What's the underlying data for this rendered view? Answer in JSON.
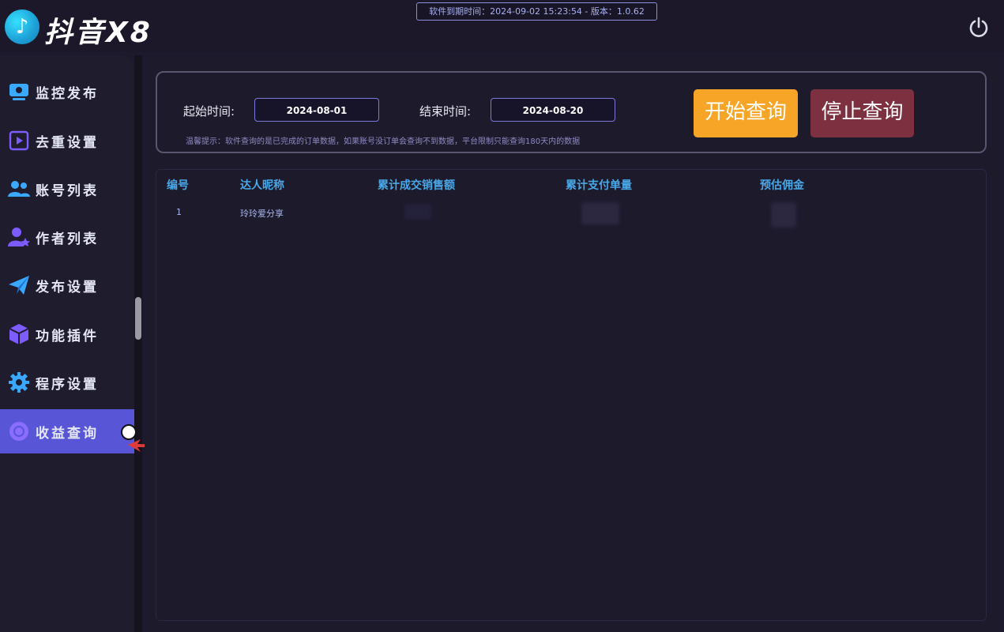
{
  "header": {
    "logo_glyph": "♪",
    "app_title": "抖音X8",
    "expire_info": "软件到期时间：2024-09-02 15:23:54 - 版本：1.0.62",
    "power_icon": "power-icon"
  },
  "sidebar": {
    "items": [
      {
        "label": "监控发布",
        "icon": "monitor-icon",
        "color": "#3aa8ff"
      },
      {
        "label": "去重设置",
        "icon": "video-edit-icon",
        "color": "#7c5cff"
      },
      {
        "label": "账号列表",
        "icon": "users-icon",
        "color": "#3aa8ff"
      },
      {
        "label": "作者列表",
        "icon": "user-star-icon",
        "color": "#7c5cff"
      },
      {
        "label": "发布设置",
        "icon": "send-icon",
        "color": "#3aa8ff"
      },
      {
        "label": "功能插件",
        "icon": "cube-icon",
        "color": "#7c5cff"
      },
      {
        "label": "程序设置",
        "icon": "gear-icon",
        "color": "#3aa8ff"
      },
      {
        "label": "收益查询",
        "icon": "coin-icon",
        "color": "#8a6cff",
        "active": true
      }
    ]
  },
  "query": {
    "start_label": "起始时间:",
    "start_value": "2024-08-01",
    "end_label": "结束时间:",
    "end_value": "2024-08-20",
    "tip": "温馨提示：软件查询的是已完成的订单数据，如果账号没订单会查询不到数据，平台限制只能查询180天内的数据",
    "start_button": "开始查询",
    "stop_button": "停止查询"
  },
  "table": {
    "columns": [
      "编号",
      "达人昵称",
      "累计成交销售额",
      "累计支付单量",
      "预估佣金"
    ],
    "rows": [
      {
        "id": "1",
        "nickname": "玲玲爱分享",
        "sales": "",
        "orders": "",
        "commission": ""
      }
    ]
  },
  "colors": {
    "accent": "#5856d6",
    "start_btn": "#f6a527",
    "stop_btn": "#7d3040",
    "header_text": "#48a8e8"
  }
}
